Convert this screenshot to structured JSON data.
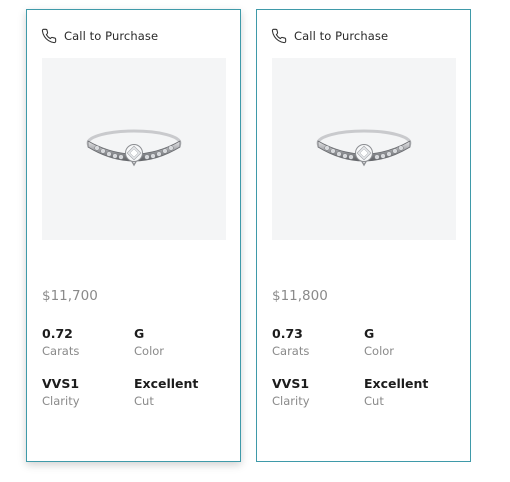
{
  "cards": [
    {
      "cta_label": "Call to Purchase",
      "phone_icon": "phone-icon",
      "image": "diamond-solitaire-ring-image",
      "price": "$11,700",
      "carats_value": "0.72",
      "carats_label": "Carats",
      "color_value": "G",
      "color_label": "Color",
      "clarity_value": "VVS1",
      "clarity_label": "Clarity",
      "cut_value": "Excellent",
      "cut_label": "Cut",
      "selected": true
    },
    {
      "cta_label": "Call to Purchase",
      "phone_icon": "phone-icon",
      "image": "diamond-solitaire-ring-image",
      "price": "$11,800",
      "carats_value": "0.73",
      "carats_label": "Carats",
      "color_value": "G",
      "color_label": "Color",
      "clarity_value": "VVS1",
      "clarity_label": "Clarity",
      "cut_value": "Excellent",
      "cut_label": "Cut",
      "selected": false
    }
  ],
  "colors": {
    "card_border": "#3f9aa9",
    "image_background": "#f4f5f6",
    "price_text": "#8a8a8a",
    "value_text": "#1c1c1c"
  }
}
